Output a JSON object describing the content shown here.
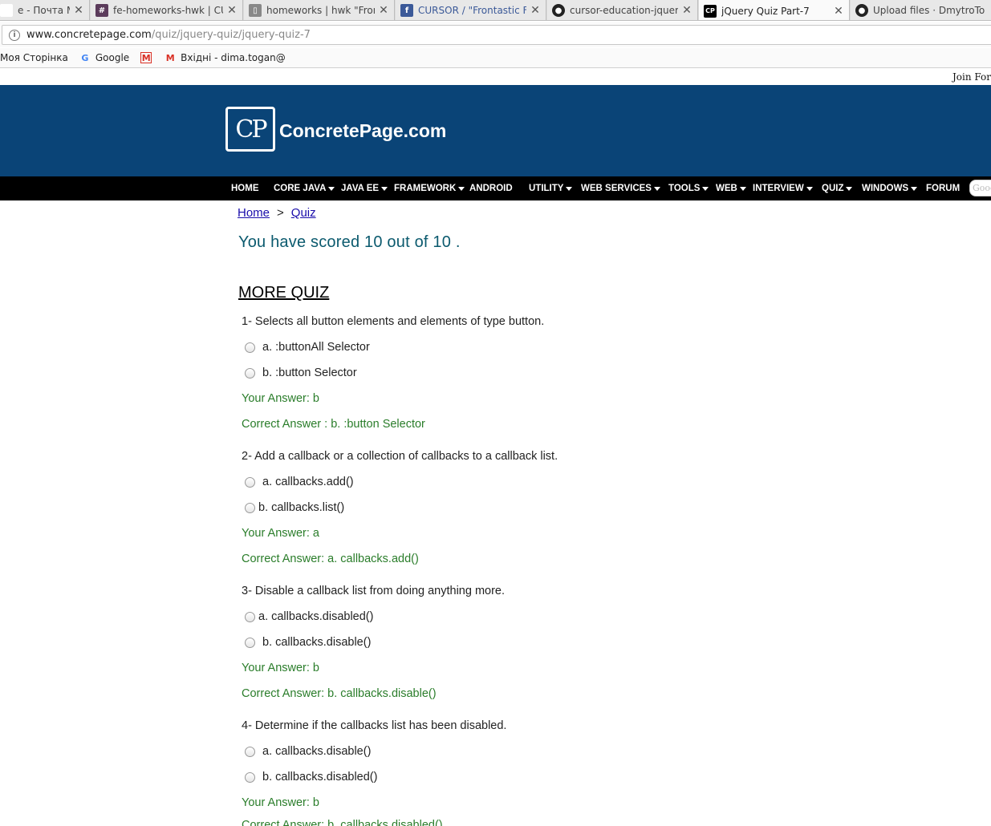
{
  "browser": {
    "tabs": [
      {
        "title": "e - Почта Mail.",
        "favicon": "mail-icon",
        "active": false
      },
      {
        "title": "fe-homeworks-hwk | CU",
        "favicon": "slack-hash-icon",
        "active": false
      },
      {
        "title": "homeworks | hwk \"Front",
        "favicon": "page-icon",
        "active": false
      },
      {
        "title": "CURSOR / \"Frontastic Fr",
        "favicon": "facebook-icon",
        "active": false
      },
      {
        "title": "cursor-education-jquery",
        "favicon": "github-icon",
        "active": false
      },
      {
        "title": "jQuery Quiz Part-7",
        "favicon": "cp-icon",
        "active": true
      },
      {
        "title": "Upload files · DmytroTo",
        "favicon": "github-icon",
        "active": false
      }
    ],
    "url_host": "www.concretepage.com",
    "url_path": "/quiz/jquery-quiz/jquery-quiz-7",
    "bookmarks": [
      {
        "label": "Моя Сторінка",
        "icon": ""
      },
      {
        "label": "Google",
        "icon": "google-icon"
      },
      {
        "label": "",
        "icon": "gmail-icon"
      },
      {
        "label": "Вхідні - dima.togan@",
        "icon": "gmail-icon"
      }
    ]
  },
  "site": {
    "join_text": "Join For",
    "logo_mark": "CP",
    "logo_text": "ConcretePage.com",
    "nav": [
      {
        "label": "HOME",
        "dropdown": false
      },
      {
        "label": "CORE JAVA",
        "dropdown": true
      },
      {
        "label": "JAVA EE",
        "dropdown": true
      },
      {
        "label": "FRAMEWORK",
        "dropdown": true
      },
      {
        "label": "ANDROID",
        "dropdown": false
      },
      {
        "label": "UTILITY",
        "dropdown": true
      },
      {
        "label": "WEB SERVICES",
        "dropdown": true
      },
      {
        "label": "TOOLS",
        "dropdown": true
      },
      {
        "label": "WEB",
        "dropdown": true
      },
      {
        "label": "INTERVIEW",
        "dropdown": true
      },
      {
        "label": "QUIZ",
        "dropdown": true
      },
      {
        "label": "WINDOWS",
        "dropdown": true
      },
      {
        "label": "FORUM",
        "dropdown": false
      }
    ],
    "search_placeholder": "Goog"
  },
  "content": {
    "breadcrumb": {
      "home": "Home",
      "separator": ">",
      "quiz": "Quiz"
    },
    "score": "You have scored 10 out of 10 .",
    "more_quiz": "MORE QUIZ",
    "questions": [
      {
        "question": "1- Selects all button elements and elements of type button.",
        "options": [
          "a. :buttonAll Selector",
          "b. :button Selector"
        ],
        "your_answer": "Your Answer: b",
        "correct_answer": "Correct Answer : b. :button Selector"
      },
      {
        "question": "2- Add a callback or a collection of callbacks to a callback list.",
        "options": [
          "a. callbacks.add()",
          "b. callbacks.list()"
        ],
        "your_answer": "Your Answer: a",
        "correct_answer": "Correct Answer: a. callbacks.add()"
      },
      {
        "question": "3- Disable a callback list from doing anything more.",
        "options": [
          "a. callbacks.disabled()",
          "b. callbacks.disable()"
        ],
        "your_answer": "Your Answer: b",
        "correct_answer": "Correct Answer: b. callbacks.disable()"
      },
      {
        "question": "4- Determine if the callbacks list has been disabled.",
        "options": [
          "a. callbacks.disable()",
          "b. callbacks.disabled()"
        ],
        "your_answer": "Your Answer: b",
        "correct_answer": "Correct Answer: b. callbacks.disabled()"
      }
    ]
  },
  "colors": {
    "header_bg": "#0a4477",
    "nav_bg": "#000000",
    "score_text": "#0b5a6e",
    "answer_text": "#2a7d2a",
    "link": "#1a0dab"
  }
}
